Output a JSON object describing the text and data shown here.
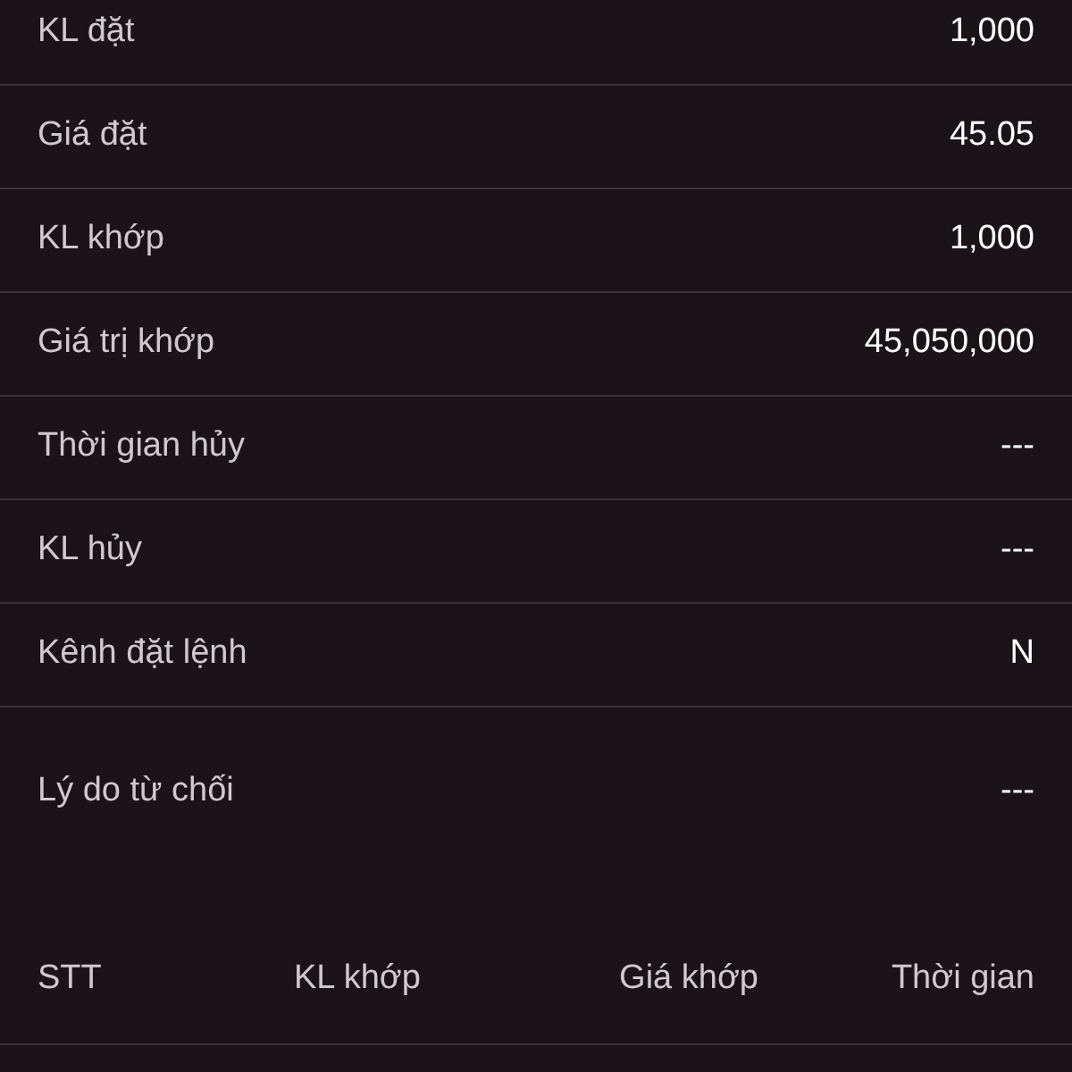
{
  "details": [
    {
      "label": "KL đặt",
      "value": "1,000"
    },
    {
      "label": "Giá đặt",
      "value": "45.05"
    },
    {
      "label": "KL khớp",
      "value": "1,000"
    },
    {
      "label": "Giá trị khớp",
      "value": "45,050,000"
    },
    {
      "label": "Thời gian hủy",
      "value": "---"
    },
    {
      "label": "KL hủy",
      "value": "---"
    },
    {
      "label": "Kênh đặt lệnh",
      "value": "N"
    },
    {
      "label": "Lý do từ chối",
      "value": "---"
    }
  ],
  "match_table": {
    "columns": [
      "STT",
      "KL khớp",
      "Giá khớp",
      "Thời gian"
    ]
  }
}
